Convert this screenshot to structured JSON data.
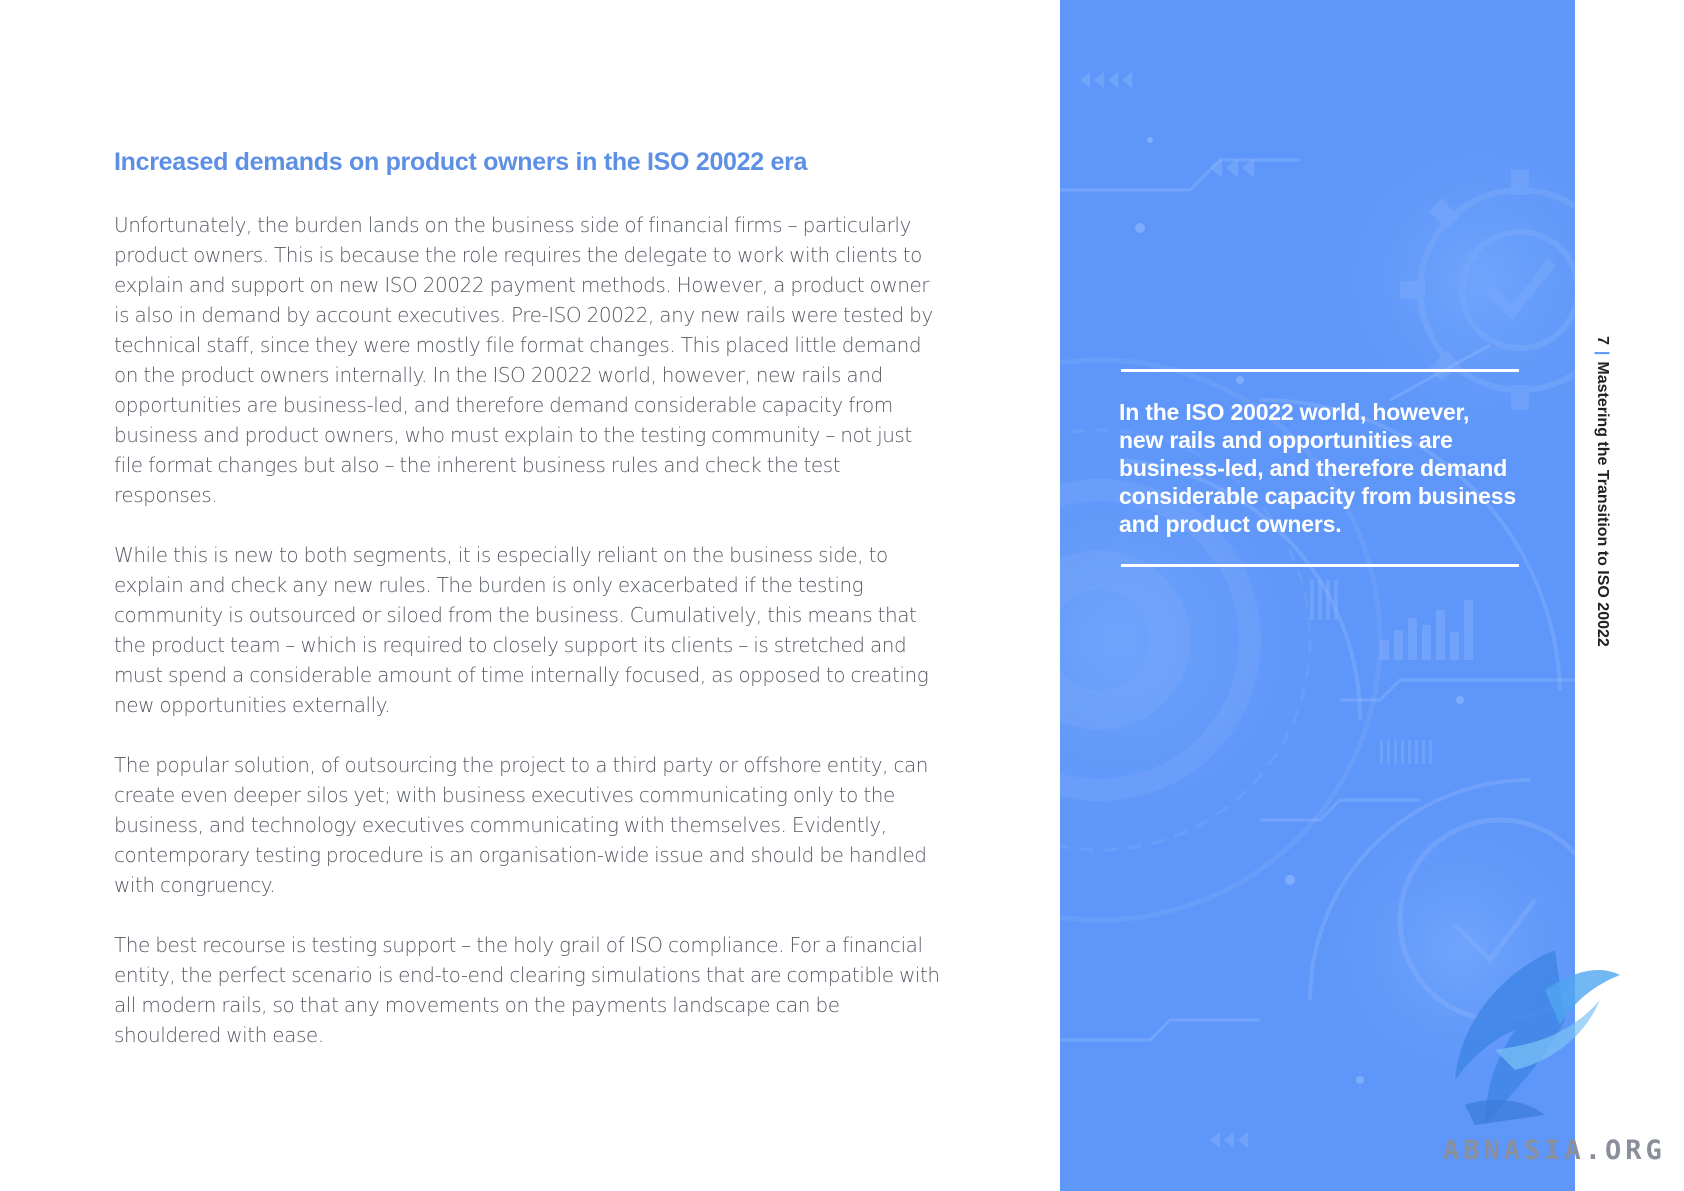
{
  "article": {
    "heading": "Increased demands on product owners in the ISO 20022 era",
    "paragraphs": [
      "Unfortunately, the burden lands on the business side of financial firms – particularly product owners. This is because the role requires the delegate to work with clients to explain and support on new ISO 20022 payment methods. However, a product owner is also in demand by account executives. Pre-ISO 20022, any new rails were tested by technical staff, since they were mostly file format changes. This placed little demand on the product owners internally. In the ISO 20022 world, however, new rails and opportunities are business-led, and therefore demand considerable capacity from business and product owners, who must explain to the testing community – not just file format changes but also – the inherent business rules and check the test responses.",
      "While this is new to both segments, it is especially reliant on the business side, to explain and check any new rules. The burden is only exacerbated if the testing community is outsourced or siloed from the business. Cumulatively, this means that the product team – which is required to closely support its clients – is stretched and must spend a considerable amount of time internally focused, as opposed to creating new opportunities externally.",
      "The popular solution, of outsourcing the project to a third party or offshore entity, can create even deeper silos yet; with business executives communicating only to the business, and technology executives communicating with themselves. Evidently, contemporary testing procedure is an organisation-wide issue and should be handled with congruency.",
      "The best recourse is testing support – the holy grail of ISO compliance. For a financial entity, the perfect scenario is end-to-end clearing simulations that are compatible with all modern rails, so that any movements on the payments landscape can be shouldered with ease."
    ]
  },
  "pull_quote": {
    "text": "In the ISO 20022 world, however, new rails and opportunities are business-led, and therefore demand considerable capacity from business and product owners."
  },
  "page_label": {
    "number": "7",
    "separator": "|",
    "title": "Mastering the Transition to ISO 20022"
  },
  "watermark": {
    "text": "ABNASIA.ORG"
  },
  "colors": {
    "heading_blue": "#5d8fe4",
    "panel_blue": "#5e96f9",
    "body_text": "#555a63"
  }
}
